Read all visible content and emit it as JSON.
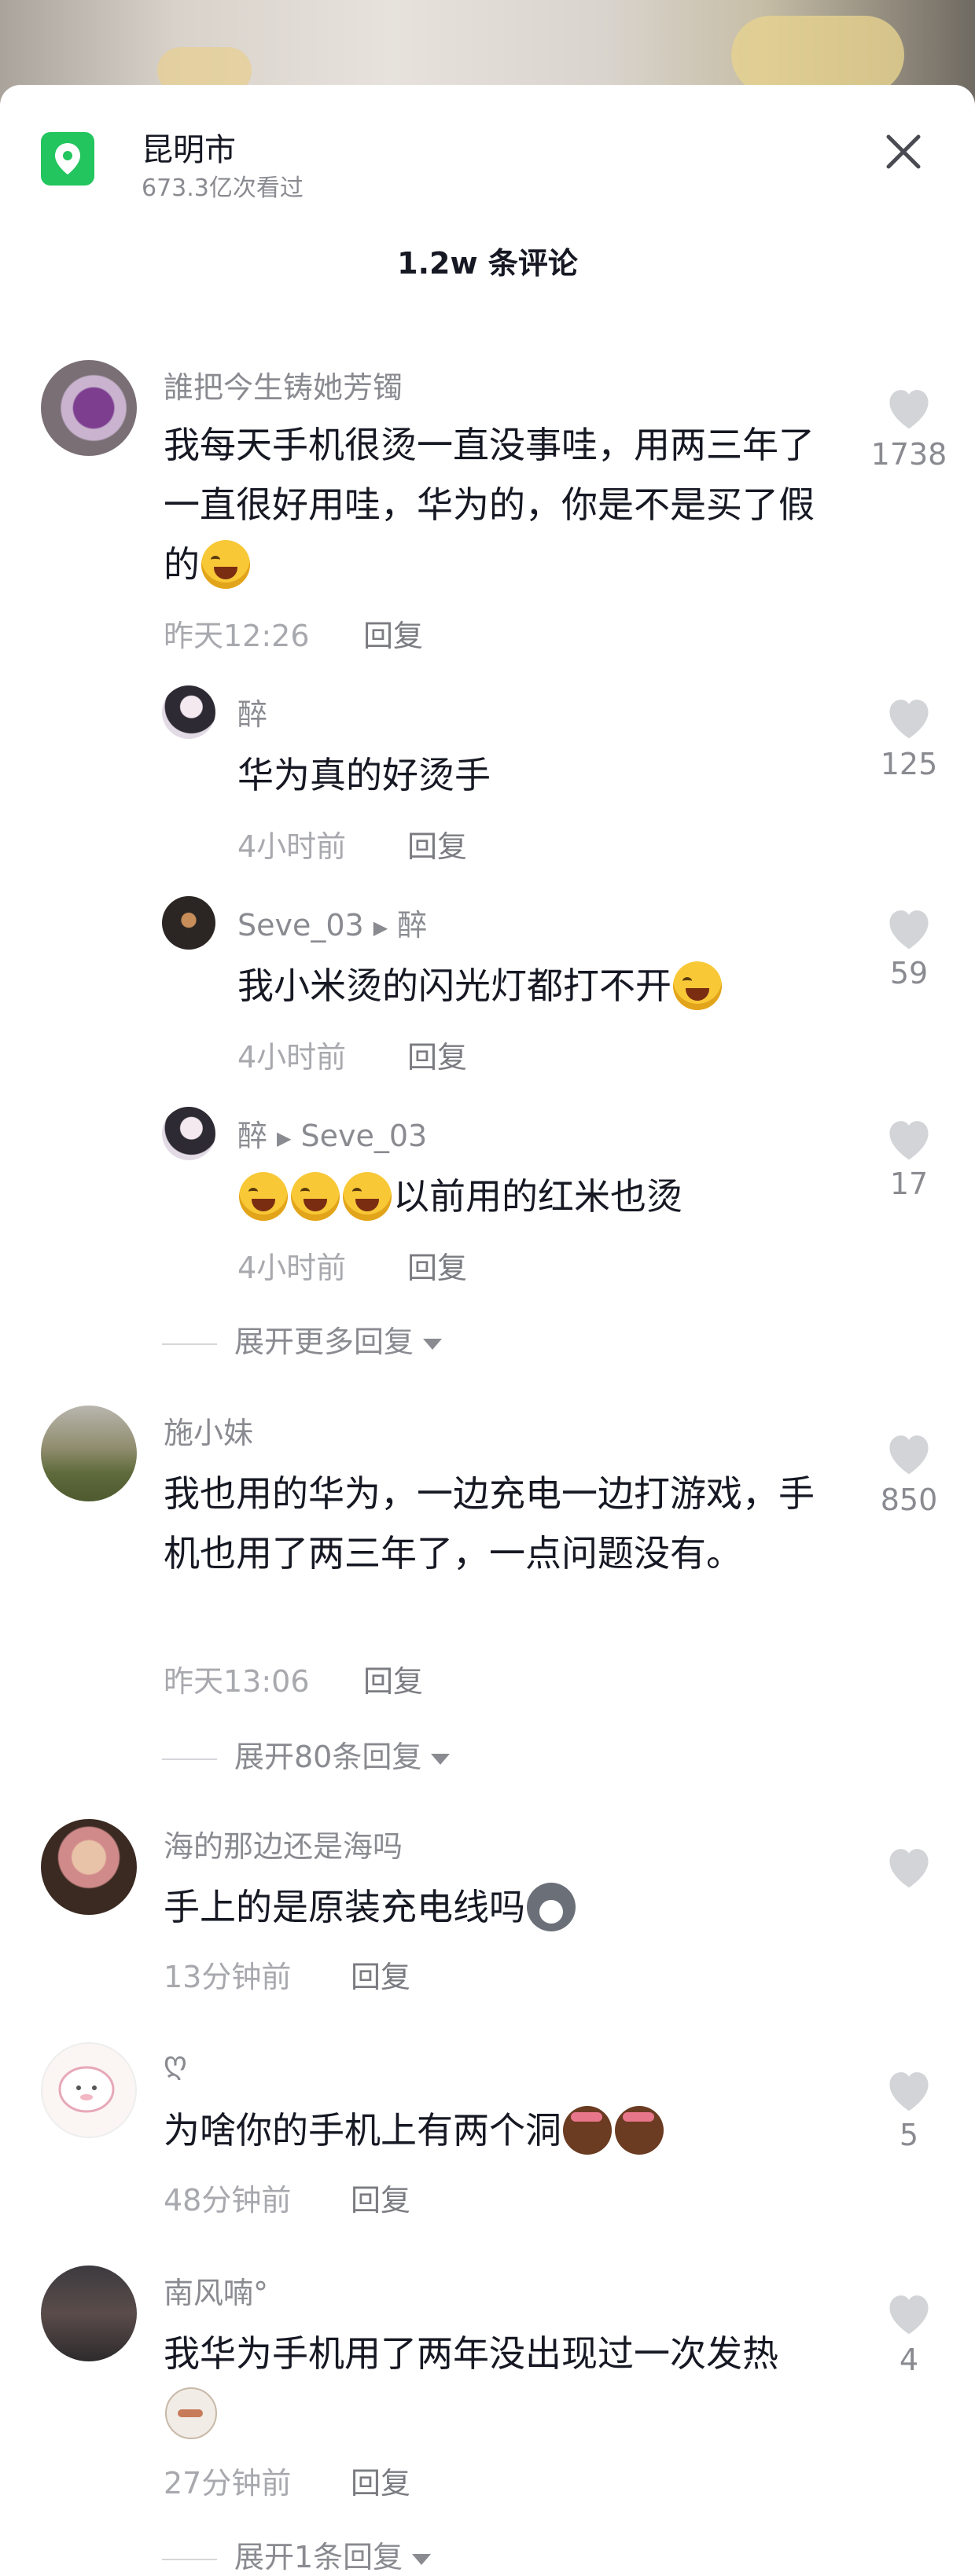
{
  "header": {
    "location_title": "昆明市",
    "views": "673.3亿次看过",
    "comment_count": "1.2w 条评论"
  },
  "icons": {
    "location": "location-pin-icon",
    "close": "close-icon",
    "like": "heart-icon",
    "reply_arrow": "play-arrow-icon",
    "expand": "caret-down-icon"
  },
  "colors": {
    "accent_green": "#22c55e",
    "text_primary": "#161823",
    "text_secondary": "#8a8b91"
  },
  "comments": [
    {
      "user": "誰把今生铸她芳镯",
      "text": "我每天手机很烫一直没事哇，用两三年了一直很好用哇，华为的，你是不是买了假的",
      "time": "昨天12:26",
      "reply_label": "回复",
      "likes": "1738",
      "replies": [
        {
          "user": "醉",
          "text": "华为真的好烫手",
          "time": "4小时前",
          "reply_label": "回复",
          "likes": "125"
        },
        {
          "user": "Seve_03",
          "to": "醉",
          "text": "我小米烫的闪光灯都打不开",
          "time": "4小时前",
          "reply_label": "回复",
          "likes": "59"
        },
        {
          "user": "醉",
          "to": "Seve_03",
          "text": "以前用的红米也烫",
          "time": "4小时前",
          "reply_label": "回复",
          "likes": "17"
        }
      ],
      "expand_label": "展开更多回复"
    },
    {
      "user": "施小妹",
      "text": "我也用的华为，一边充电一边打游戏，手机也用了两三年了，一点问题没有。",
      "time": "昨天13:06",
      "reply_label": "回复",
      "likes": "850",
      "expand_label": "展开80条回复"
    },
    {
      "user": "海的那边还是海吗",
      "text": "手上的是原装充电线吗",
      "time": "13分钟前",
      "reply_label": "回复",
      "likes": ""
    },
    {
      "user": "ღ",
      "text": "为啥你的手机上有两个洞",
      "time": "48分钟前",
      "reply_label": "回复",
      "likes": "5"
    },
    {
      "user": "南风喃°",
      "text": "我华为手机用了两年没出现过一次发热",
      "time": "27分钟前",
      "reply_label": "回复",
      "likes": "4",
      "expand_label": "展开1条回复"
    }
  ]
}
